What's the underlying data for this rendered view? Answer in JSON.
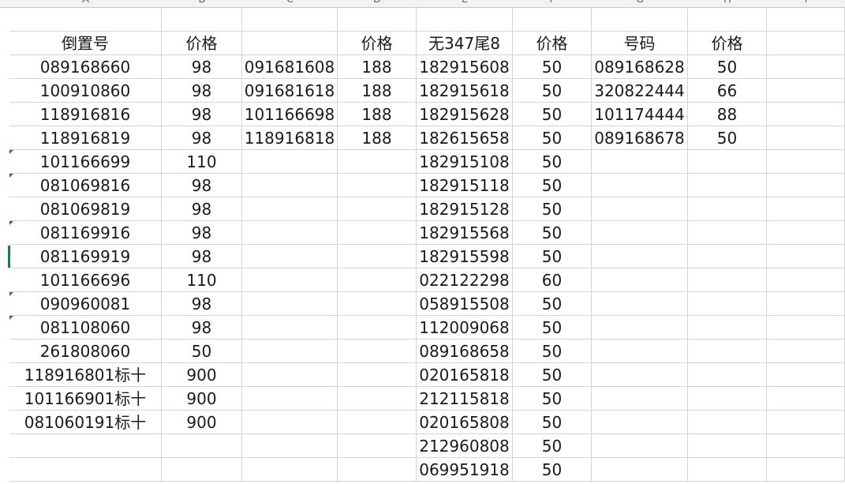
{
  "sheet": {
    "column_letters": [
      "A",
      "B",
      "C",
      "D",
      "E",
      "F",
      "G",
      "H",
      "I"
    ],
    "rows": [
      [
        "",
        "",
        "",
        "",
        "",
        "",
        "",
        "",
        ""
      ],
      [
        "倒置号",
        "价格",
        "",
        "价格",
        "无347尾8",
        "价格",
        "号码",
        "价格",
        ""
      ],
      [
        "089168660",
        "98",
        "091681608",
        "188",
        "182915608",
        "50",
        "089168628",
        "50",
        ""
      ],
      [
        "100910860",
        "98",
        "091681618",
        "188",
        "182915618",
        "50",
        "320822444",
        "66",
        ""
      ],
      [
        "118916816",
        "98",
        "101166698",
        "188",
        "182915628",
        "50",
        "101174444",
        "88",
        ""
      ],
      [
        "118916819",
        "98",
        "118916818",
        "188",
        "182615658",
        "50",
        "089168678",
        "50",
        ""
      ],
      [
        "101166699",
        "110",
        "",
        "",
        "182915108",
        "50",
        "",
        "",
        ""
      ],
      [
        "081069816",
        "98",
        "",
        "",
        "182915118",
        "50",
        "",
        "",
        ""
      ],
      [
        "081069819",
        "98",
        "",
        "",
        "182915128",
        "50",
        "",
        "",
        ""
      ],
      [
        "081169916",
        "98",
        "",
        "",
        "182915568",
        "50",
        "",
        "",
        ""
      ],
      [
        "081169919",
        "98",
        "",
        "",
        "182915598",
        "50",
        "",
        "",
        ""
      ],
      [
        "101166696",
        "110",
        "",
        "",
        "022122298",
        "60",
        "",
        "",
        ""
      ],
      [
        "090960081",
        "98",
        "",
        "",
        "058915508",
        "50",
        "",
        "",
        ""
      ],
      [
        "081108060",
        "98",
        "",
        "",
        "112009068",
        "50",
        "",
        "",
        ""
      ],
      [
        "261808060",
        "50",
        "",
        "",
        "089168658",
        "50",
        "",
        "",
        ""
      ],
      [
        "118916801标十",
        "900",
        "",
        "",
        "020165818",
        "50",
        "",
        "",
        ""
      ],
      [
        "101166901标十",
        "900",
        "",
        "",
        "212115818",
        "50",
        "",
        "",
        ""
      ],
      [
        "081060191标十",
        "900",
        "",
        "",
        "020165808",
        "50",
        "",
        "",
        ""
      ],
      [
        "",
        "",
        "",
        "",
        "212960808",
        "50",
        "",
        "",
        ""
      ],
      [
        "",
        "",
        "",
        "",
        "069951918",
        "50",
        "",
        "",
        ""
      ]
    ],
    "colors": {
      "grid_line": "#d4d4d4",
      "header_bg": "#f2f2f2",
      "text": "#1a1a1a",
      "error_marker": "#1e7d3e"
    }
  }
}
